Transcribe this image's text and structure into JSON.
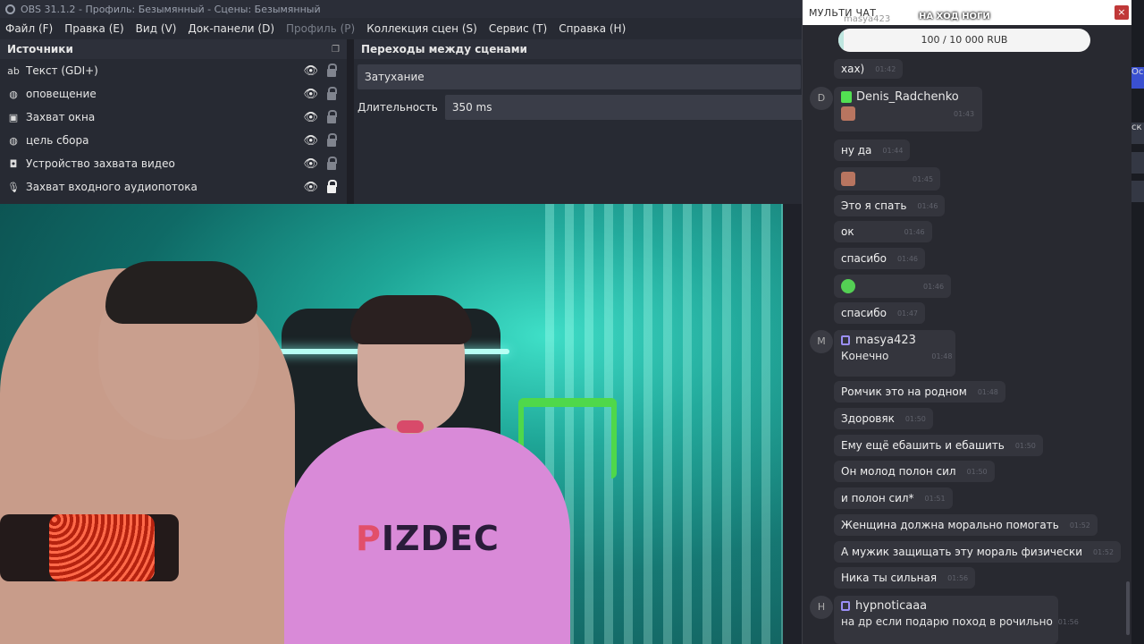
{
  "window": {
    "title": "OBS 31.1.2 - Профиль: Безымянный - Сцены: Безымянный"
  },
  "menu": {
    "file": "Файл (F)",
    "edit": "Правка (E)",
    "view": "Вид (V)",
    "docks": "Док-панели (D)",
    "profile": "Профиль (P)",
    "scene_collection": "Коллекция сцен (S)",
    "tools": "Сервис (T)",
    "help": "Справка (H)"
  },
  "sources": {
    "title": "Источники",
    "items": [
      {
        "label": "Текст (GDI+)",
        "icon": "text-icon",
        "visible": true,
        "locked": false
      },
      {
        "label": "оповещение",
        "icon": "browser-icon",
        "visible": true,
        "locked": false
      },
      {
        "label": "Захват окна",
        "icon": "window-icon",
        "visible": true,
        "locked": false
      },
      {
        "label": "цель сбора",
        "icon": "browser-icon",
        "visible": true,
        "locked": false
      },
      {
        "label": "Устройство захвата видео",
        "icon": "camera-icon",
        "visible": true,
        "locked": false
      },
      {
        "label": "Захват входного аудиопотока",
        "icon": "microphone-icon",
        "visible": true,
        "locked": true
      }
    ]
  },
  "transitions": {
    "title": "Переходы между сценами",
    "selected": "Затухание",
    "duration_label": "Длительность",
    "duration_value": "350 ms"
  },
  "camera": {
    "shirt_prefix": "P",
    "shirt_rest": "IZDEC"
  },
  "right_buttons": [
    "Ос",
    "ск"
  ],
  "chat": {
    "title": "МУЛЬТИ ЧАТ",
    "close": "×",
    "goal": {
      "title": "НА ХОД НОГИ",
      "label": "100 / 10 000 RUB",
      "progress": 0.01,
      "partial_user": "masya423"
    },
    "messages": [
      {
        "text": "хах)",
        "time": "01:42"
      },
      {
        "avatar": "D",
        "user": "Denis_Radchenko",
        "platform": "kick",
        "time": "01:43"
      },
      {
        "text": "ну да",
        "time": "01:44"
      },
      {
        "time": "01:45"
      },
      {
        "text": "Это я  спать",
        "time": "01:46"
      },
      {
        "text": "ок",
        "time": "01:46"
      },
      {
        "text": "спасибо",
        "time": "01:46"
      },
      {
        "time": "01:46"
      },
      {
        "text": "спасибо",
        "time": "01:47"
      },
      {
        "avatar": "M",
        "user": "masya423",
        "platform": "twitch",
        "text": "Конечно",
        "time": "01:48"
      },
      {
        "text": "Ромчик это на родном",
        "time": "01:48"
      },
      {
        "text": "Здоровяк",
        "time": "01:50"
      },
      {
        "text": "Ему ещё ебашить и ебашить",
        "time": "01:50"
      },
      {
        "text": "Он молод полон сил",
        "time": "01:50"
      },
      {
        "text": "и полон сил*",
        "time": "01:51"
      },
      {
        "text": "Женщина должна морально помогать",
        "time": "01:52"
      },
      {
        "text": "А мужик защищать эту мораль физически",
        "time": "01:52"
      },
      {
        "text": "Ника ты сильная",
        "time": "01:56"
      },
      {
        "avatar": "H",
        "user": "hypnoticaaa",
        "platform": "twitch",
        "text": "на др если подарю поход в рочильно",
        "time": "01:56"
      }
    ]
  }
}
